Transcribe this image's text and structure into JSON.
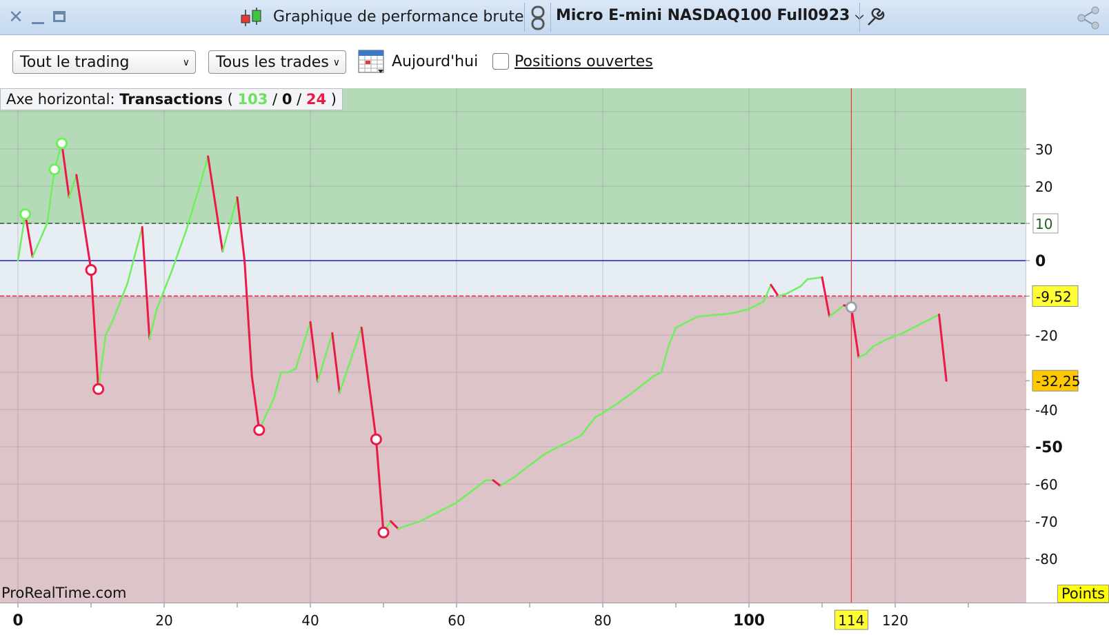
{
  "window": {
    "title": "Graphique de performance brute",
    "instrument": "Micro E-mini NASDAQ100 Full0923"
  },
  "toolbar": {
    "scope_select": "Tout le trading",
    "trades_select": "Tous les trades",
    "date_label": "Aujourd'hui",
    "open_positions_label": "Positions ouvertes",
    "open_positions_checked": false
  },
  "chart_info": {
    "prefix": "Axe horizontal:",
    "axis_name": "Transactions",
    "winning": "103",
    "neutral": "0",
    "losing": "24",
    "winning_color": "#4cdc42",
    "losing_color": "#ee1846"
  },
  "watermark": "ProRealTime.com",
  "units_label": "Points",
  "colors": {
    "gain_zone": "#b5dab8",
    "neutral_zone": "#e6eef3",
    "loss_zone": "#dcc4c8",
    "up_line": "#6df05a",
    "down_line": "#ee1846",
    "zero_line": "#1a1acc"
  },
  "chart_data": {
    "type": "line",
    "xlabel": "",
    "ylabel": "",
    "xlim": [
      0,
      134
    ],
    "ylim": [
      -88,
      46
    ],
    "x_ticks": [
      "0",
      "20",
      "40",
      "60",
      "80",
      "100",
      "120"
    ],
    "y_ticks": [
      "30",
      "20",
      "10",
      "0",
      "-9,52",
      "-20",
      "-32,25",
      "-40",
      "-50",
      "-60",
      "-70",
      "-80"
    ],
    "x_bold_ticks": [
      "0",
      "100"
    ],
    "y_bold_ticks": [
      "0",
      "-50"
    ],
    "upper_threshold": "10",
    "lower_threshold": "-9,52",
    "last_value": "-32,25",
    "cursor_x": "114",
    "cursor_value": -11.8,
    "equity": [
      [
        0,
        0
      ],
      [
        1,
        12.5
      ],
      [
        2,
        1
      ],
      [
        4,
        10
      ],
      [
        5,
        24.5
      ],
      [
        6,
        31.5
      ],
      [
        7,
        17
      ],
      [
        8,
        23
      ],
      [
        10,
        -2.5
      ],
      [
        11,
        -34.5
      ],
      [
        12,
        -20
      ],
      [
        13,
        -16
      ],
      [
        15,
        -6
      ],
      [
        17,
        9
      ],
      [
        18,
        -21
      ],
      [
        19,
        -13
      ],
      [
        21,
        -3
      ],
      [
        23,
        8
      ],
      [
        25,
        21
      ],
      [
        26,
        28
      ],
      [
        28,
        2.5
      ],
      [
        30,
        17
      ],
      [
        31,
        0
      ],
      [
        32,
        -31
      ],
      [
        33,
        -45.5
      ],
      [
        35,
        -37
      ],
      [
        36,
        -30
      ],
      [
        37,
        -30
      ],
      [
        38,
        -29
      ],
      [
        40,
        -16.5
      ],
      [
        41,
        -32.5
      ],
      [
        43,
        -19.5
      ],
      [
        44,
        -35.5
      ],
      [
        47,
        -18
      ],
      [
        49,
        -48
      ],
      [
        50,
        -73
      ],
      [
        51,
        -70
      ],
      [
        52,
        -72
      ],
      [
        55,
        -70
      ],
      [
        60,
        -65
      ],
      [
        64,
        -59
      ],
      [
        65,
        -59
      ],
      [
        66,
        -60.5
      ],
      [
        68,
        -58
      ],
      [
        70,
        -55
      ],
      [
        72,
        -52
      ],
      [
        75,
        -49
      ],
      [
        77,
        -47
      ],
      [
        79,
        -42
      ],
      [
        80,
        -41
      ],
      [
        83,
        -37
      ],
      [
        85,
        -34
      ],
      [
        87,
        -31
      ],
      [
        88,
        -30
      ],
      [
        89,
        -23
      ],
      [
        90,
        -18
      ],
      [
        91,
        -17
      ],
      [
        93,
        -15
      ],
      [
        96,
        -14.5
      ],
      [
        98,
        -14
      ],
      [
        100,
        -13
      ],
      [
        102,
        -11
      ],
      [
        103,
        -6.5
      ],
      [
        104,
        -9.5
      ],
      [
        105,
        -9
      ],
      [
        107,
        -7
      ],
      [
        108,
        -5
      ],
      [
        110,
        -4.5
      ],
      [
        111,
        -15
      ],
      [
        113,
        -12
      ],
      [
        114,
        -12.5
      ],
      [
        115,
        -26
      ],
      [
        116,
        -25
      ],
      [
        117,
        -23
      ],
      [
        119,
        -21
      ],
      [
        121,
        -19.5
      ],
      [
        123,
        -17.5
      ],
      [
        125,
        -15.5
      ],
      [
        126,
        -14.5
      ],
      [
        127,
        -32.25
      ]
    ],
    "markers": [
      {
        "x": 1,
        "y": 12.5,
        "kind": "high"
      },
      {
        "x": 5,
        "y": 24.5,
        "kind": "high"
      },
      {
        "x": 6,
        "y": 31.5,
        "kind": "high"
      },
      {
        "x": 10,
        "y": -2.5,
        "kind": "low"
      },
      {
        "x": 11,
        "y": -34.5,
        "kind": "low"
      },
      {
        "x": 33,
        "y": -45.5,
        "kind": "low"
      },
      {
        "x": 49,
        "y": -48,
        "kind": "low"
      },
      {
        "x": 50,
        "y": -73,
        "kind": "low"
      },
      {
        "x": 114,
        "y": -12.5,
        "kind": "cursor"
      }
    ]
  }
}
